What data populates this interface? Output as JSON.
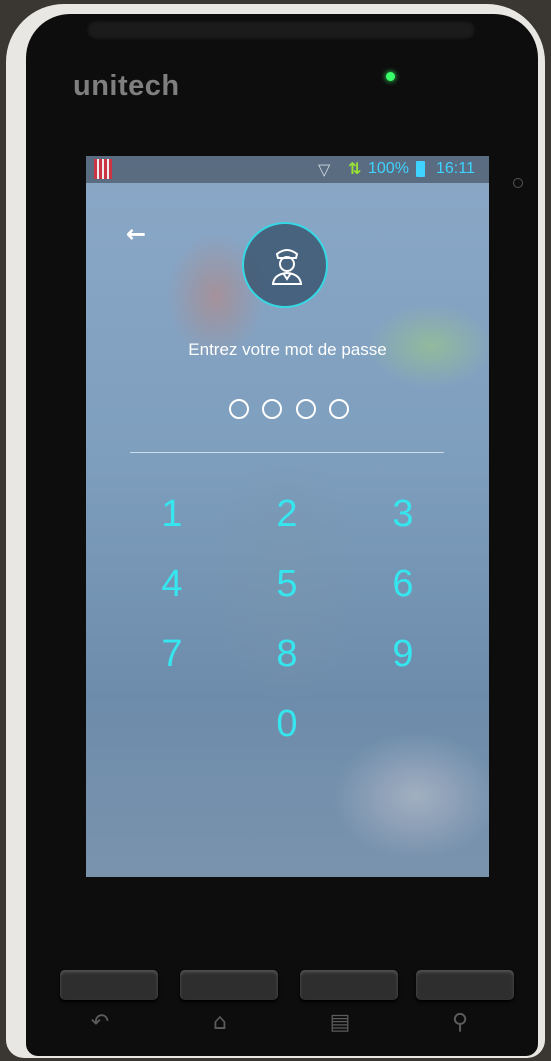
{
  "device": {
    "brand": "unitech"
  },
  "status_bar": {
    "battery": "100%",
    "time": "16:11",
    "icons": [
      "screenshot-icon",
      "wifi-icon",
      "network-icon",
      "battery-icon"
    ]
  },
  "lock_screen": {
    "prompt": "Entrez votre mot de passe",
    "pin_length": 4,
    "keys": [
      "1",
      "2",
      "3",
      "4",
      "5",
      "6",
      "7",
      "8",
      "9",
      "0"
    ],
    "accent_color": "#35e6ef"
  },
  "nav_bar": {
    "icons": [
      "back-icon",
      "home-icon",
      "menu-icon",
      "search-icon"
    ]
  }
}
